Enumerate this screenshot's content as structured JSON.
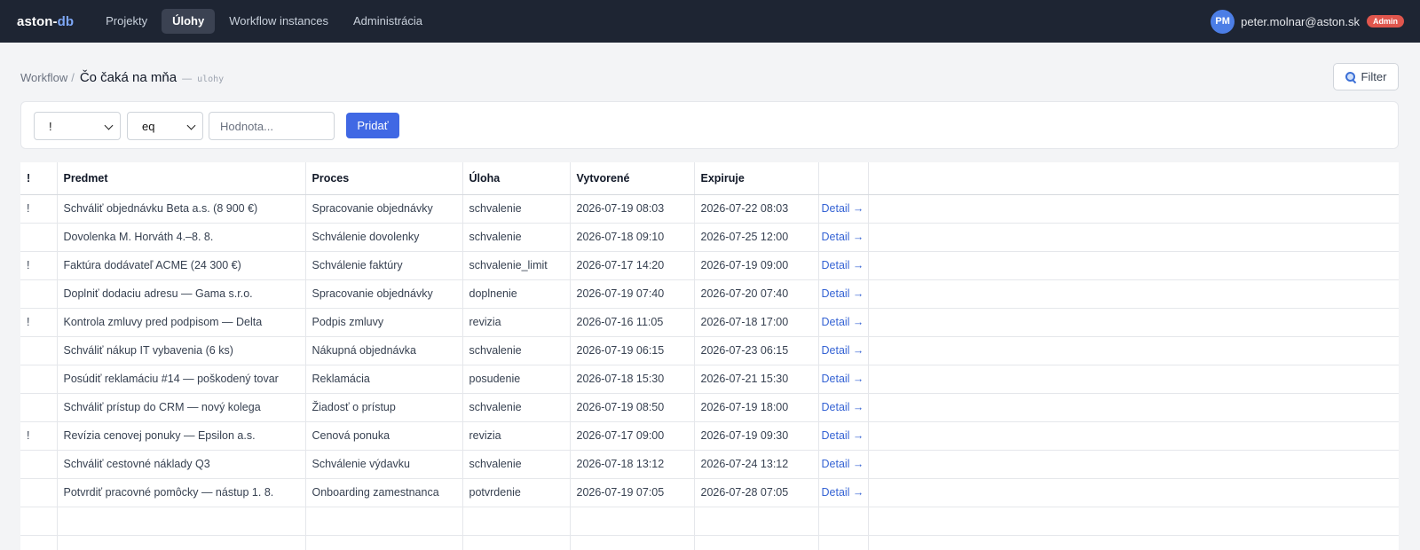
{
  "brand": {
    "part1": "aston-",
    "part2": "db"
  },
  "nav": [
    {
      "label": "Projekty",
      "active": false
    },
    {
      "label": "Úlohy",
      "active": true
    },
    {
      "label": "Workflow instances",
      "active": false
    },
    {
      "label": "Administrácia",
      "active": false
    }
  ],
  "user": {
    "initials": "PM",
    "email": "peter.molnar@aston.sk",
    "role_badge": "Admin"
  },
  "breadcrumb": {
    "parent": "Workflow",
    "separator": "/",
    "current": "Čo čaká na mňa",
    "dash": "—",
    "code": "ulohy"
  },
  "filter_button": {
    "label": "Filter",
    "icon": "search-icon"
  },
  "filter_bar": {
    "field_select": "!",
    "operator_select": "eq",
    "value_placeholder": "Hodnota...",
    "add_label": "Pridať"
  },
  "table": {
    "headers": [
      "!",
      "Predmet",
      "Proces",
      "Úloha",
      "Vytvorené",
      "Expiruje"
    ],
    "rows": [
      {
        "flag": "!",
        "subject": "Schváliť objednávku Beta a.s. (8 900 €)",
        "process": "Spracovanie objednávky",
        "task": "schvalenie",
        "created": "2026-07-19 08:03",
        "expires": "2026-07-22 08:03",
        "link": "Detail →"
      },
      {
        "flag": "",
        "subject": "Dovolenka M. Horváth 4.–8. 8.",
        "process": "Schválenie dovolenky",
        "task": "schvalenie",
        "created": "2026-07-18 09:10",
        "expires": "2026-07-25 12:00",
        "link": "Detail →"
      },
      {
        "flag": "!",
        "subject": "Faktúra dodávateľ ACME (24 300 €)",
        "process": "Schválenie faktúry",
        "task": "schvalenie_limit",
        "created": "2026-07-17 14:20",
        "expires": "2026-07-19 09:00",
        "link": "Detail →"
      },
      {
        "flag": "",
        "subject": "Doplniť dodaciu adresu — Gama s.r.o.",
        "process": "Spracovanie objednávky",
        "task": "doplnenie",
        "created": "2026-07-19 07:40",
        "expires": "2026-07-20 07:40",
        "link": "Detail →"
      },
      {
        "flag": "!",
        "subject": "Kontrola zmluvy pred podpisom — Delta",
        "process": "Podpis zmluvy",
        "task": "revizia",
        "created": "2026-07-16 11:05",
        "expires": "2026-07-18 17:00",
        "link": "Detail →"
      },
      {
        "flag": "",
        "subject": "Schváliť nákup IT vybavenia (6 ks)",
        "process": "Nákupná objednávka",
        "task": "schvalenie",
        "created": "2026-07-19 06:15",
        "expires": "2026-07-23 06:15",
        "link": "Detail →"
      },
      {
        "flag": "",
        "subject": "Posúdiť reklamáciu #14 — poškodený tovar",
        "process": "Reklamácia",
        "task": "posudenie",
        "created": "2026-07-18 15:30",
        "expires": "2026-07-21 15:30",
        "link": "Detail →"
      },
      {
        "flag": "",
        "subject": "Schváliť prístup do CRM — nový kolega",
        "process": "Žiadosť o prístup",
        "task": "schvalenie",
        "created": "2026-07-19 08:50",
        "expires": "2026-07-19 18:00",
        "link": "Detail →"
      },
      {
        "flag": "!",
        "subject": "Revízia cenovej ponuky — Epsilon a.s.",
        "process": "Cenová ponuka",
        "task": "revizia",
        "created": "2026-07-17 09:00",
        "expires": "2026-07-19 09:30",
        "link": "Detail →"
      },
      {
        "flag": "",
        "subject": "Schváliť cestovné náklady Q3",
        "process": "Schválenie výdavku",
        "task": "schvalenie",
        "created": "2026-07-18 13:12",
        "expires": "2026-07-24 13:12",
        "link": "Detail →"
      },
      {
        "flag": "",
        "subject": "Potvrdiť pracovné pomôcky — nástup 1. 8.",
        "process": "Onboarding zamestnanca",
        "task": "potvrdenie",
        "created": "2026-07-19 07:05",
        "expires": "2026-07-28 07:05",
        "link": "Detail →"
      }
    ]
  },
  "colors": {
    "nav_bg": "#1e2533",
    "accent": "#4068e4",
    "link": "#3563d4",
    "admin_badge": "#e0564d"
  }
}
